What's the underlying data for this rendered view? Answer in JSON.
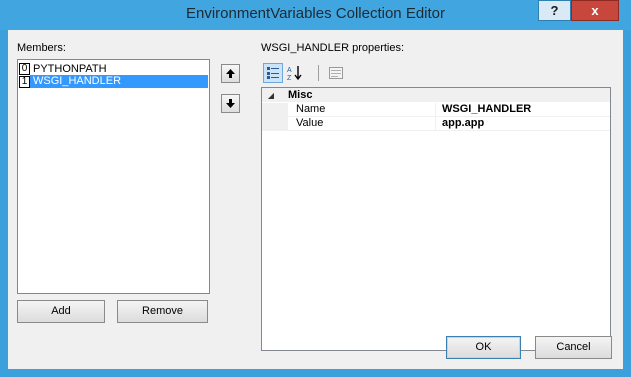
{
  "window": {
    "title": "EnvironmentVariables Collection Editor",
    "help_glyph": "?",
    "close_glyph": "x"
  },
  "members": {
    "label": "Members:",
    "items": [
      {
        "index": "0",
        "name": "PYTHONPATH",
        "selected": false
      },
      {
        "index": "1",
        "name": "WSGI_HANDLER",
        "selected": true
      }
    ],
    "add_label": "Add",
    "remove_label": "Remove"
  },
  "properties": {
    "label": "WSGI_HANDLER properties:",
    "category": "Misc",
    "category_toggle": "◢",
    "rows": [
      {
        "name": "Name",
        "value": "WSGI_HANDLER"
      },
      {
        "name": "Value",
        "value": "app.app"
      }
    ]
  },
  "footer": {
    "ok_label": "OK",
    "cancel_label": "Cancel"
  },
  "icons": {
    "move_up": "arrow-up-icon",
    "move_down": "arrow-down-icon",
    "categorized": "categorized-icon",
    "alphabetical": "sort-alphabetical-icon",
    "property_pages": "property-pages-icon"
  },
  "colors": {
    "titlebar": "#41a6e0",
    "selection": "#3399ff",
    "close": "#c7473c"
  }
}
